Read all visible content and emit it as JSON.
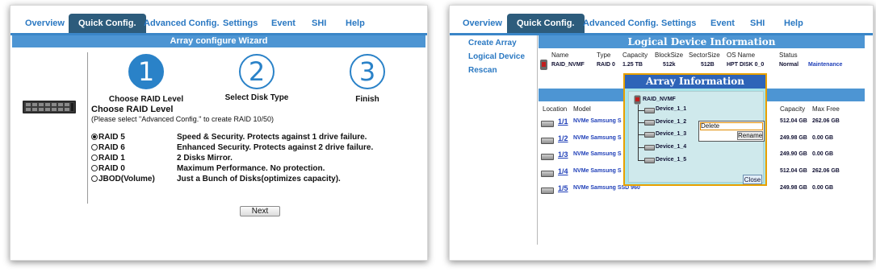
{
  "left": {
    "tabs": [
      {
        "label": "Overview",
        "active": false
      },
      {
        "label": "Quick Config.",
        "active": true
      },
      {
        "label": "Advanced Config.",
        "active": false
      },
      {
        "label": "Settings",
        "active": false
      },
      {
        "label": "Event",
        "active": false
      },
      {
        "label": "SHI",
        "active": false
      },
      {
        "label": "Help",
        "active": false
      }
    ],
    "wizard_title": "Array configure Wizard",
    "steps": [
      {
        "number": "1",
        "label": "Choose RAID Level",
        "done": true
      },
      {
        "number": "2",
        "label": "Select Disk Type",
        "done": false
      },
      {
        "number": "3",
        "label": "Finish",
        "done": false
      }
    ],
    "section_heading": "Choose RAID Level",
    "section_note": "(Please select \"Advanced Config.\" to create RAID 10/50)",
    "raid_options": [
      {
        "label": "RAID 5",
        "desc": "Speed & Security. Protects against 1 drive failure.",
        "selected": true
      },
      {
        "label": "RAID 6",
        "desc": "Enhanced Security. Protects against 2 drive failure.",
        "selected": false
      },
      {
        "label": "RAID 1",
        "desc": "2 Disks Mirror.",
        "selected": false
      },
      {
        "label": "RAID 0",
        "desc": "Maximum Performance. No protection.",
        "selected": false
      },
      {
        "label": "JBOD(Volume)",
        "desc": "Just a Bunch of Disks(optimizes capacity).",
        "selected": false
      }
    ],
    "next_label": "Next"
  },
  "right": {
    "tabs": [
      {
        "label": "Overview",
        "active": false
      },
      {
        "label": "Quick Config.",
        "active": true
      },
      {
        "label": "Advanced Config.",
        "active": false
      },
      {
        "label": "Settings",
        "active": false
      },
      {
        "label": "Event",
        "active": false
      },
      {
        "label": "SHI",
        "active": false
      },
      {
        "label": "Help",
        "active": false
      }
    ],
    "sidebar": [
      "Create Array",
      "Logical Device",
      "Rescan"
    ],
    "ldi_title": "Logical Device Information",
    "ldi_headers": [
      "Name",
      "Type",
      "Capacity",
      "BlockSize",
      "SectorSize",
      "OS Name",
      "Status"
    ],
    "ldi_row": {
      "name": "RAID_NVMF",
      "type": "RAID 0",
      "capacity": "1.25 TB",
      "blocksize": "512k",
      "sectorsize": "512B",
      "os_name": "HPT DISK 0_0",
      "status": "Normal",
      "action": "Maintenance"
    },
    "dev_headers": {
      "location": "Location",
      "model": "Model",
      "capacity": "Capacity",
      "max_free": "Max Free"
    },
    "devices": [
      {
        "loc": "1/1",
        "model": "NVMe Samsung S",
        "capacity": "512.04 GB",
        "max_free": "262.06 GB"
      },
      {
        "loc": "1/2",
        "model": "NVMe Samsung S",
        "capacity": "249.98 GB",
        "max_free": "0.00 GB"
      },
      {
        "loc": "1/3",
        "model": "NVMe Samsung S",
        "capacity": "249.90 GB",
        "max_free": "0.00 GB"
      },
      {
        "loc": "1/4",
        "model": "NVMe Samsung S",
        "capacity": "512.04 GB",
        "max_free": "262.06 GB"
      },
      {
        "loc": "1/5",
        "model": "NVMe Samsung SSD 960",
        "capacity": "249.98 GB",
        "max_free": "0.00 GB"
      }
    ],
    "popup": {
      "title": "Array Information",
      "root": "RAID_NVMF",
      "devices": [
        "Device_1_1",
        "Device_1_2",
        "Device_1_3",
        "Device_1_4",
        "Device_1_5"
      ],
      "menu_delete": "Delete",
      "menu_rename": "Rename",
      "close": "Close"
    }
  },
  "colors": {
    "accent": "#2a78c2",
    "active_tab": "#2d5c7c",
    "title_bar": "#4d95d3",
    "popup_bg": "#a8e4e8",
    "popup_border": "#e8a000"
  }
}
